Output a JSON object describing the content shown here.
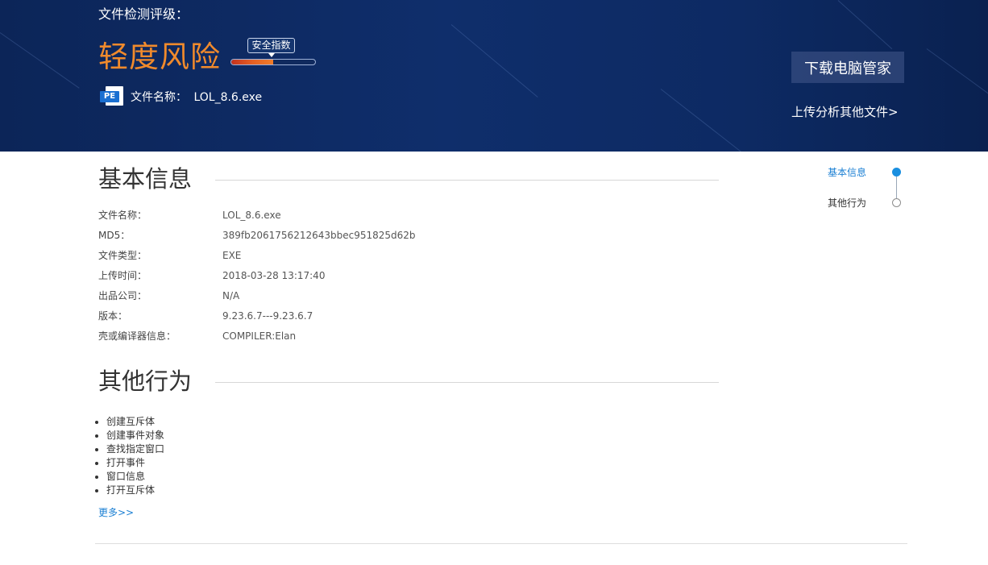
{
  "header": {
    "rating_label": "文件检测评级：",
    "risk_level": "轻度风险",
    "safety_index_label": "安全指数",
    "safety_index_fill": 0.5,
    "file_type_badge": "PE",
    "file_name_label": "文件名称：",
    "file_name_value": "LOL_8.6.exe",
    "download_button": "下载电脑管家",
    "upload_link": "上传分析其他文件>"
  },
  "basic_info": {
    "title": "基本信息",
    "rows": [
      {
        "key": "文件名称：",
        "value": "LOL_8.6.exe"
      },
      {
        "key": "MD5：",
        "value": "389fb2061756212643bbec951825d62b"
      },
      {
        "key": "文件类型：",
        "value": "EXE"
      },
      {
        "key": "上传时间：",
        "value": "2018-03-28 13:17:40"
      },
      {
        "key": "出品公司：",
        "value": "N/A"
      },
      {
        "key": "版本：",
        "value": "9.23.6.7---9.23.6.7"
      },
      {
        "key": "壳或编译器信息：",
        "value": "COMPILER:Elan"
      }
    ]
  },
  "other_behavior": {
    "title": "其他行为",
    "items": [
      "创建互斥体",
      "创建事件对象",
      "查找指定窗口",
      "打开事件",
      "窗口信息",
      "打开互斥体"
    ],
    "more_link": "更多>>"
  },
  "side_nav": {
    "items": [
      "基本信息",
      "其他行为"
    ]
  },
  "colors": {
    "banner": "#0f2e6b",
    "risk": "#f08a2c",
    "accent": "#1a7fd3"
  }
}
